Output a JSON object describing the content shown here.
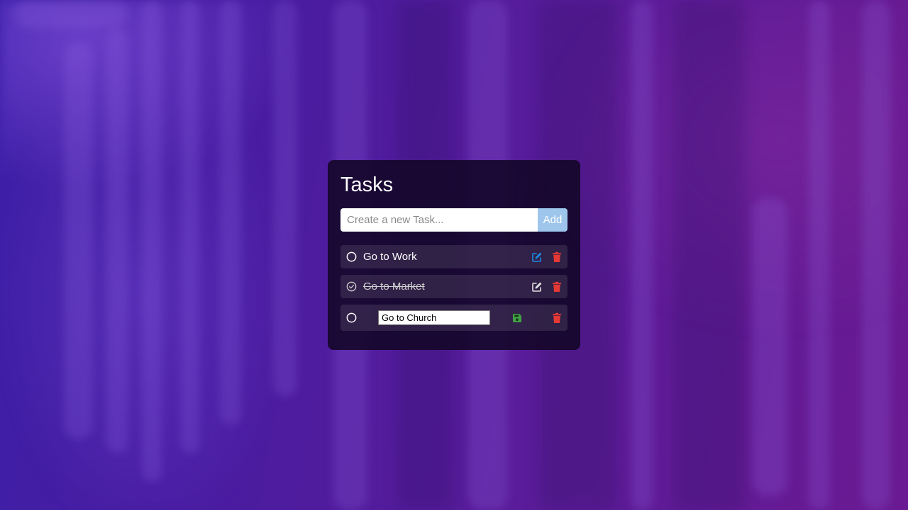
{
  "app": {
    "title": "Tasks"
  },
  "new_task": {
    "placeholder": "Create a new Task...",
    "value": "",
    "add_label": "Add"
  },
  "tasks": [
    {
      "label": "Go to Work",
      "completed": false,
      "editing": false
    },
    {
      "label": "Go to Market",
      "completed": true,
      "editing": false
    },
    {
      "label": "Go to Church",
      "completed": false,
      "editing": true
    }
  ],
  "colors": {
    "edit_active": "#1e88e5",
    "edit_inactive": "#e0e0e0",
    "delete": "#e53935",
    "save": "#43a047",
    "add_button": "#9ec6ec"
  },
  "icons": {
    "incomplete": "circle-icon",
    "complete": "check-circle-icon",
    "edit": "pen-to-square-icon",
    "delete": "trash-icon",
    "save": "floppy-disk-icon"
  }
}
